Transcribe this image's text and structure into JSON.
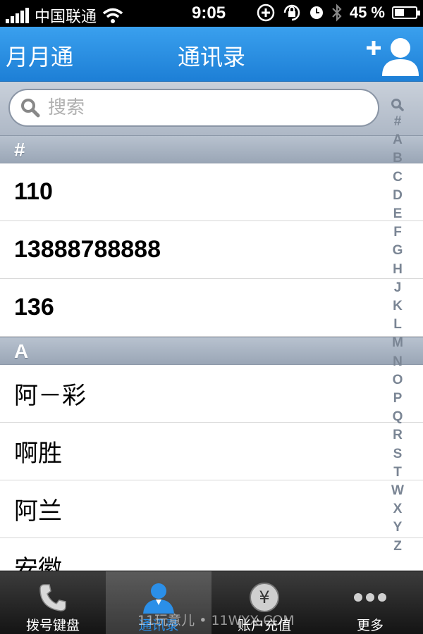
{
  "status_bar": {
    "carrier": "中国联通",
    "time": "9:05",
    "battery_percent": "45 %",
    "battery_level": 0.45
  },
  "nav": {
    "left_label": "月月通",
    "title": "通讯录",
    "add_contact_icon": "add-contact-icon"
  },
  "search": {
    "placeholder": "搜索"
  },
  "sections": [
    {
      "header": "#",
      "rows": [
        "110",
        "13888788888",
        "136"
      ]
    },
    {
      "header": "A",
      "rows": [
        "阿－彩",
        "啊胜",
        "阿兰",
        "安徽"
      ]
    }
  ],
  "index_letters": [
    "#",
    "A",
    "B",
    "C",
    "D",
    "E",
    "F",
    "G",
    "H",
    "J",
    "K",
    "L",
    "M",
    "N",
    "O",
    "P",
    "Q",
    "R",
    "S",
    "T",
    "W",
    "X",
    "Y",
    "Z"
  ],
  "tabs": [
    {
      "label": "拨号键盘",
      "icon": "phone-icon",
      "active": false
    },
    {
      "label": "通讯录",
      "icon": "contacts-icon",
      "active": true
    },
    {
      "label": "账户充值",
      "icon": "yen-icon",
      "active": false
    },
    {
      "label": "更多",
      "icon": "more-icon",
      "active": false
    }
  ],
  "watermark": "11玩意儿 • 11WYX.COM",
  "colors": {
    "nav_blue": "#2a8fe6",
    "active_tab": "#2b8fe8",
    "index_gray": "#7a8594"
  }
}
